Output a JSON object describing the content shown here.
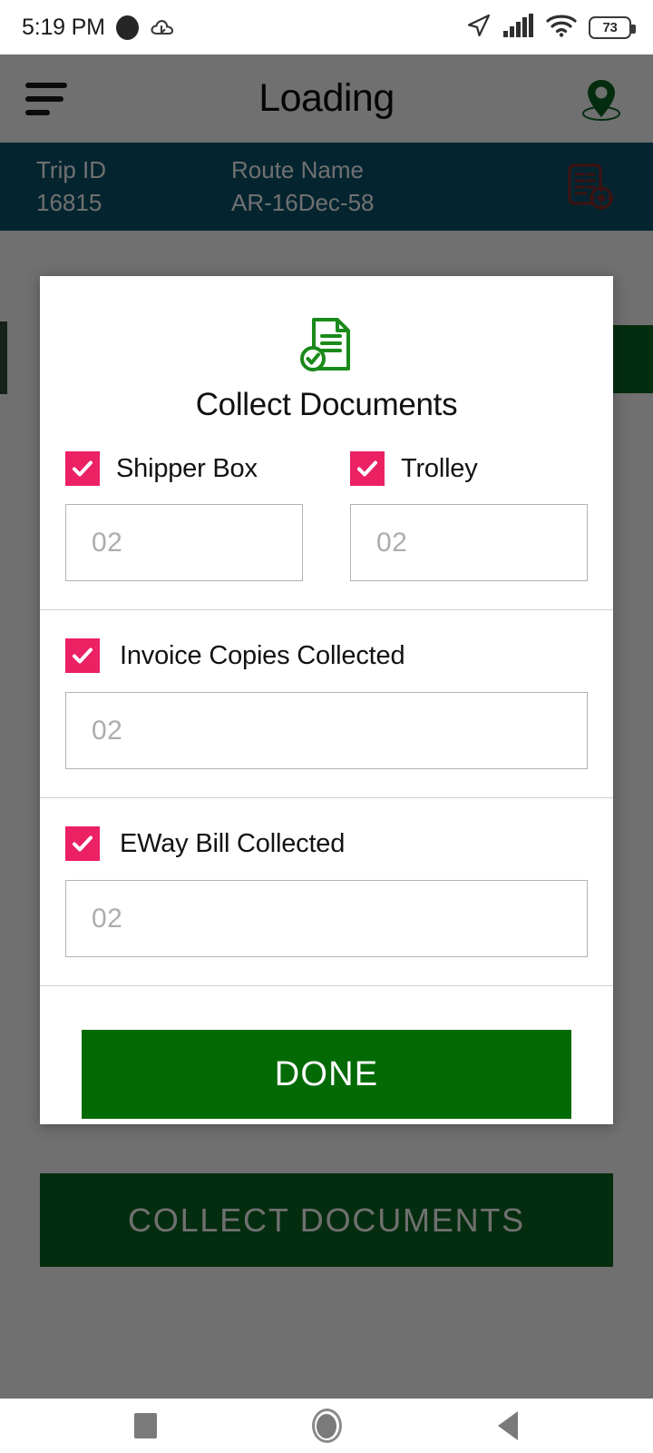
{
  "status_bar": {
    "time": "5:19 PM",
    "battery_level": "73",
    "icons": [
      "record-dot-icon",
      "cloud-icon",
      "navigation-arrow-icon",
      "cellular-signal-icon",
      "wifi-icon",
      "battery-icon"
    ]
  },
  "app_bar": {
    "title": "Loading",
    "menu_icon": "hamburger-menu-icon",
    "location_icon": "map-pin-icon"
  },
  "trip_bar": {
    "trip_id_label": "Trip ID",
    "trip_id_value": "16815",
    "route_name_label": "Route Name",
    "route_name_value": "AR-16Dec-58",
    "document_icon": "invoice-document-icon",
    "background_color": "#0a566e"
  },
  "main": {
    "collect_documents_button": "COLLECT DOCUMENTS",
    "accent_green": "#0b6623"
  },
  "dialog": {
    "icon": "document-check-icon",
    "title": "Collect Documents",
    "checkbox_color": "#EB2163",
    "rows": [
      {
        "fields": [
          {
            "label": "Shipper Box",
            "checked": true,
            "placeholder": "02",
            "value": ""
          },
          {
            "label": "Trolley",
            "checked": true,
            "placeholder": "02",
            "value": ""
          }
        ]
      },
      {
        "fields": [
          {
            "label": "Invoice Copies Collected",
            "checked": true,
            "placeholder": "02",
            "value": ""
          }
        ]
      },
      {
        "fields": [
          {
            "label": "EWay Bill Collected",
            "checked": true,
            "placeholder": "02",
            "value": ""
          }
        ]
      }
    ],
    "done_button": "DONE",
    "done_button_color": "#046A06"
  },
  "nav_bar": {
    "recents_icon": "square-recents-icon",
    "home_icon": "circle-home-icon",
    "back_icon": "triangle-back-icon"
  }
}
